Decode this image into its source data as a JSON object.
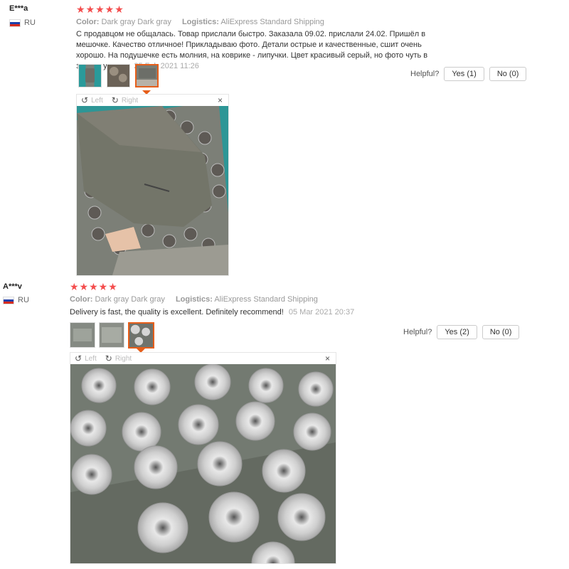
{
  "labels": {
    "color_key": "Color:",
    "logistics_key": "Logistics:",
    "helpful": "Helpful?",
    "rotate_left": "Left",
    "rotate_right": "Right",
    "close": "×"
  },
  "reviews": [
    {
      "user": "E***a",
      "country": "RU",
      "stars": "★★★★★",
      "rating": 5,
      "color": "Dark gray Dark gray",
      "logistics": "AliExpress Standard Shipping",
      "text": "С продавцом не общалась. Товар прислали быстро. Заказала 09.02. прислали 24.02. Пришёл в мешочке. Качество отличное! Прикладываю фото. Детали острые и качественные, сшит очень хорошо. На подушечке есть молния, на коврике - липучки. Цвет красивый серый, но фото чуть в зелень уходит.",
      "date": "25 Feb 2021 11:26",
      "yes": "Yes (1)",
      "no": "No (0)",
      "thumbnails": 3,
      "active_thumb": 3
    },
    {
      "user": "A***v",
      "country": "RU",
      "stars": "★★★★★",
      "rating": 5,
      "color": "Dark gray Dark gray",
      "logistics": "AliExpress Standard Shipping",
      "text": "Delivery is fast, the quality is excellent. Definitely recommend!",
      "date": "05 Mar 2021 20:37",
      "yes": "Yes (2)",
      "no": "No (0)",
      "thumbnails": 3,
      "active_thumb": 3
    }
  ],
  "colors": {
    "star": "#f44d4d",
    "active_border": "#e65e1a",
    "mat_gray": "#7a7d78",
    "teal_bg": "#2a9a9a",
    "spike_white": "#d8d8d8"
  }
}
